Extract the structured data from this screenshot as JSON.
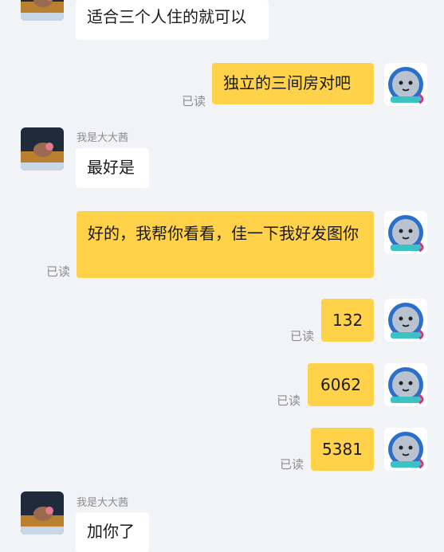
{
  "chat": {
    "contact_name": "我是大大茜",
    "messages": [
      {
        "side": "left",
        "text": "适合三个人住的就可以"
      },
      {
        "side": "right",
        "text": "独立的三间房对吧",
        "status": "已读"
      },
      {
        "side": "left",
        "name": "我是大大茜",
        "text": "最好是"
      },
      {
        "side": "right",
        "text": "好的，我帮你看看，佳一下我好发图你",
        "status": "已读"
      },
      {
        "side": "right",
        "text": "132",
        "status": "已读"
      },
      {
        "side": "right",
        "text": "6062",
        "status": "已读"
      },
      {
        "side": "right",
        "text": "5381",
        "status": "已读"
      },
      {
        "side": "left",
        "name": "我是大大茜",
        "text": "加你了"
      }
    ]
  },
  "icons": {
    "contact_avatar": "cartoon-mouse-avatar-icon",
    "self_avatar": "cat-astronaut-avatar-icon"
  },
  "colors": {
    "background": "#f2f3f7",
    "incoming_bubble": "#ffffff",
    "outgoing_bubble": "#ffd24a",
    "status_text": "#8d8d8d"
  }
}
